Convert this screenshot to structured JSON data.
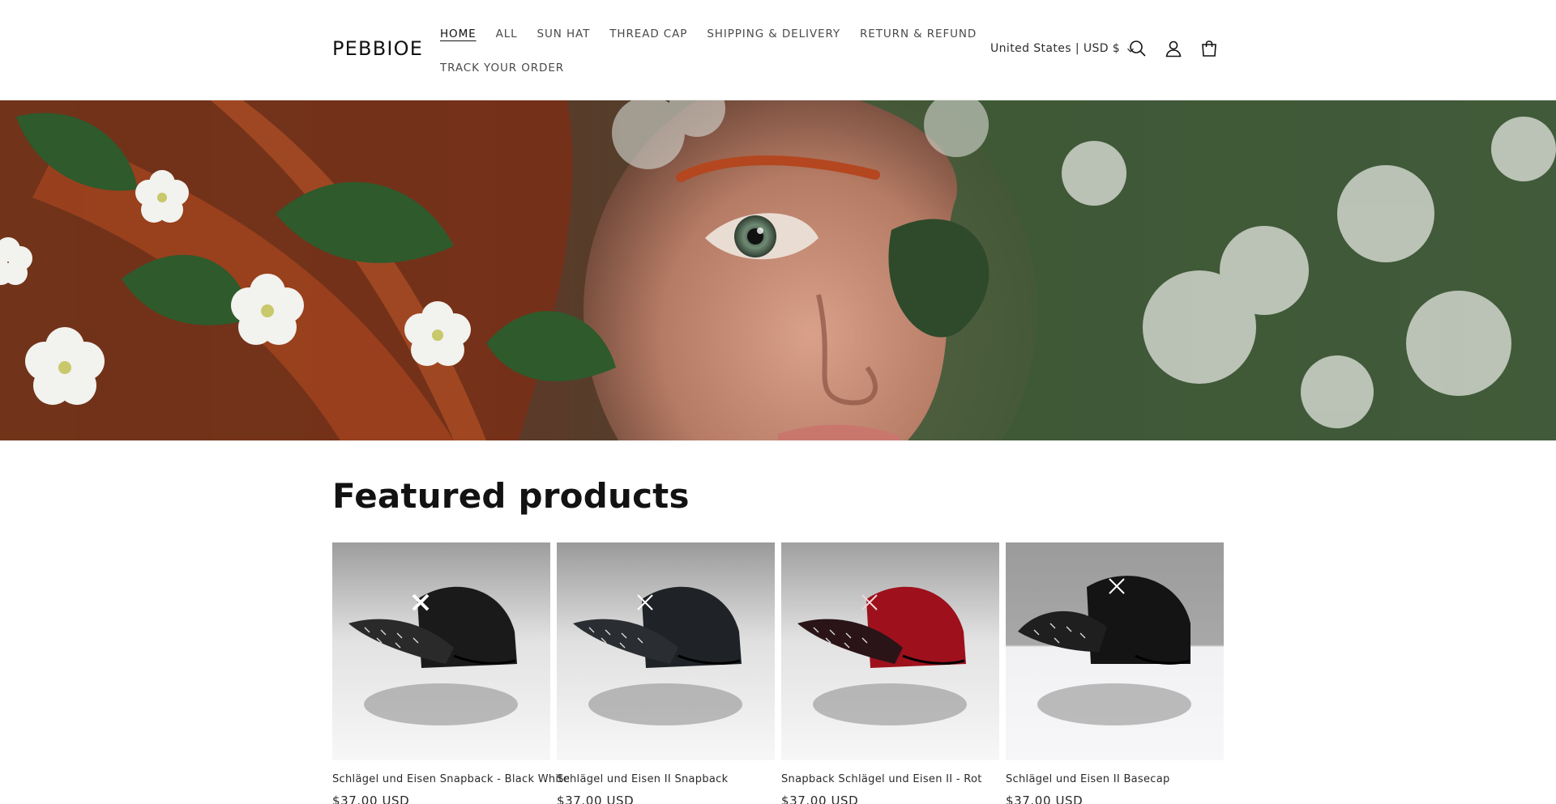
{
  "header": {
    "logo": "PEBBIOE",
    "nav_row1": [
      {
        "label": "HOME",
        "active": true
      },
      {
        "label": "ALL"
      },
      {
        "label": "SUN HAT"
      },
      {
        "label": "THREAD CAP"
      },
      {
        "label": "SHIPPING & DELIVERY"
      },
      {
        "label": "RETURN & REFUND"
      }
    ],
    "nav_row2": [
      {
        "label": "TRACK YOUR ORDER"
      }
    ],
    "country_selector": "United States | USD $",
    "icons": [
      "search-icon",
      "account-icon",
      "cart-icon"
    ]
  },
  "hero": {
    "image": "close-up portrait of red-haired woman among white flowers and green leaves"
  },
  "featured": {
    "title": "Featured products",
    "products": [
      {
        "title": "Schlägel und Eisen Snapback - Black White",
        "price": "$37.00 USD",
        "cap_color": "#1a1a1a"
      },
      {
        "title": "Schlägel und Eisen II Snapback",
        "price": "$37.00 USD",
        "cap_color": "#1f2226"
      },
      {
        "title": "Snapback Schlägel und Eisen II - Rot",
        "price": "$37.00 USD",
        "cap_color": "#9e111c"
      },
      {
        "title": "Schlägel und Eisen II Basecap",
        "price": "$37.00 USD",
        "cap_color": "#141414"
      }
    ]
  },
  "colors": {
    "text": "#121212",
    "nav_text": "#4a4a4a",
    "background": "#ffffff"
  }
}
